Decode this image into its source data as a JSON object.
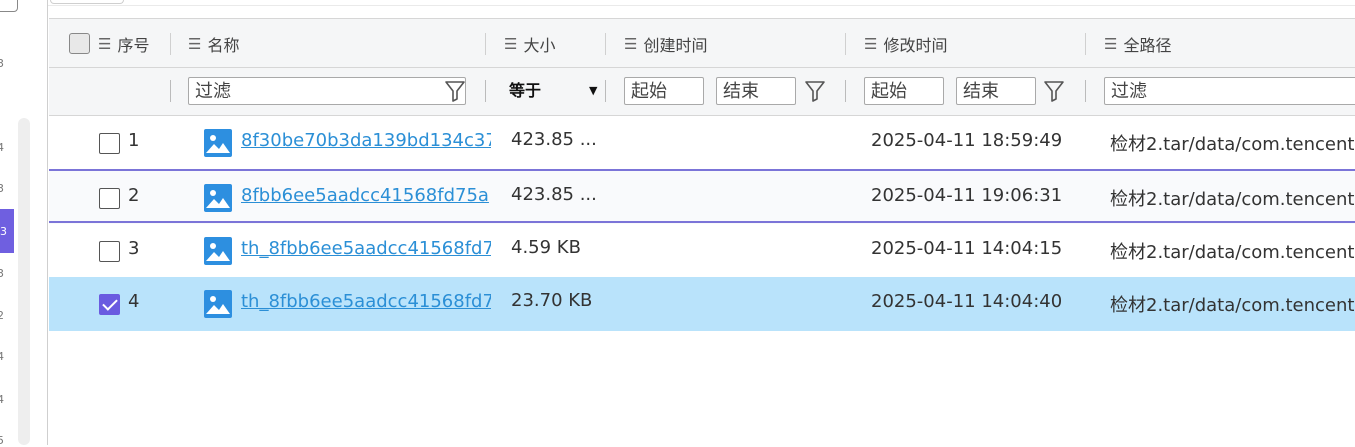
{
  "sidebar_fragment": {
    "row_numbers": [
      "3",
      "4",
      "3",
      "3",
      "3",
      "2",
      "4",
      "4",
      "5"
    ]
  },
  "table": {
    "select_all_checked": false,
    "headers": {
      "seq": "序号",
      "name": "名称",
      "size": "大小",
      "created": "创建时间",
      "modified": "修改时间",
      "path": "全路径"
    },
    "column_icon": "list-icon",
    "filters": {
      "name_placeholder": "过滤",
      "size_operator": "等于",
      "created_start": "起始",
      "created_end": "结束",
      "modified_start": "起始",
      "modified_end": "结束",
      "path_placeholder": "过滤"
    },
    "rows": [
      {
        "seq": "1",
        "name": "8f30be70b3da139bd134c37",
        "size": "423.85 ...",
        "created": "",
        "modified": "2025-04-11 18:59:49",
        "path": "检材2.tar/data/com.tencent",
        "checked": false
      },
      {
        "seq": "2",
        "name": "8fbb6ee5aadcc41568fd75a",
        "size": "423.85 ...",
        "created": "",
        "modified": "2025-04-11 19:06:31",
        "path": "检材2.tar/data/com.tencent",
        "checked": false
      },
      {
        "seq": "3",
        "name": "th_8fbb6ee5aadcc41568fd75",
        "size": "4.59 KB",
        "created": "",
        "modified": "2025-04-11 14:04:15",
        "path": "检材2.tar/data/com.tencent",
        "checked": false
      },
      {
        "seq": "4",
        "name": "th_8fbb6ee5aadcc41568fd75",
        "size": "23.70 KB",
        "created": "",
        "modified": "2025-04-11 14:04:40",
        "path": "检材2.tar/data/com.tencent",
        "checked": true
      }
    ]
  },
  "colors": {
    "accent": "#6a5be0",
    "link": "#2b8fd6",
    "selected_row": "#b9e3fb",
    "image_icon": "#2d8fe0"
  }
}
